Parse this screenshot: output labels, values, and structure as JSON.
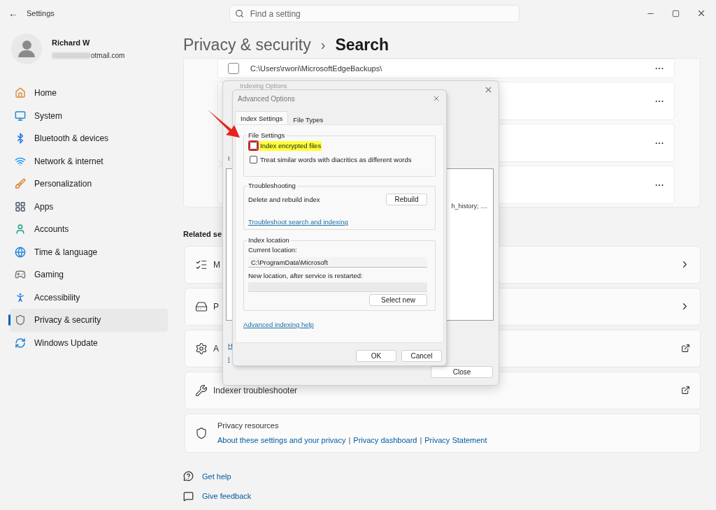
{
  "window": {
    "title": "Settings",
    "back": "←"
  },
  "search": {
    "placeholder": "Find a setting"
  },
  "user": {
    "name": "Richard W",
    "email": "otmail.com"
  },
  "sidebar": {
    "items": [
      {
        "label": "Home",
        "selected": false
      },
      {
        "label": "System",
        "selected": false
      },
      {
        "label": "Bluetooth & devices",
        "selected": false
      },
      {
        "label": "Network & internet",
        "selected": false
      },
      {
        "label": "Personalization",
        "selected": false
      },
      {
        "label": "Apps",
        "selected": false
      },
      {
        "label": "Accounts",
        "selected": false
      },
      {
        "label": "Time & language",
        "selected": false
      },
      {
        "label": "Gaming",
        "selected": false
      },
      {
        "label": "Accessibility",
        "selected": false
      },
      {
        "label": "Privacy & security",
        "selected": true
      },
      {
        "label": "Windows Update",
        "selected": false
      }
    ]
  },
  "header": {
    "parent": "Privacy & security",
    "separator": "›",
    "current": "Search"
  },
  "excluded_folders": [
    {
      "path": "C:\\Users\\rwori\\MicrosoftEdgeBackups\\",
      "checked": false,
      "more": "..."
    },
    {
      "more": "..."
    },
    {
      "more": "..."
    },
    {
      "more": "..."
    }
  ],
  "related": {
    "heading": "Related se",
    "cards": [
      {
        "title": "M"
      },
      {
        "title": "P"
      },
      {
        "title": "A"
      },
      {
        "title": "Indexer troubleshooter"
      }
    ]
  },
  "privacy_resources": {
    "title": "Privacy resources",
    "separator": "|",
    "links": [
      "About these settings and your privacy",
      "Privacy dashboard",
      "Privacy Statement"
    ]
  },
  "help_links": [
    {
      "label": "Get help"
    },
    {
      "label": "Give feedback"
    }
  ],
  "indexing_dialog": {
    "title": "Indexing Options",
    "label_fragment": "I",
    "list_text": "h_history; ....",
    "link_fragments": [
      "H",
      "I"
    ],
    "close_button": "Close"
  },
  "advanced_dialog": {
    "title": "Advanced Options",
    "tabs": [
      {
        "label": "Index Settings",
        "selected": true
      },
      {
        "label": "File Types",
        "selected": false
      }
    ],
    "file_settings": {
      "legend": "File Settings",
      "options": [
        {
          "label": "Index encrypted files",
          "checked": false,
          "highlighted": true,
          "annotated": true
        },
        {
          "label": "Treat similar words with diacritics as different words",
          "checked": false,
          "highlighted": false,
          "annotated": false
        }
      ]
    },
    "troubleshooting": {
      "legend": "Troubleshooting",
      "label": "Delete and rebuild index",
      "button": "Rebuild",
      "link": "Troubleshoot search and indexing"
    },
    "index_location": {
      "legend": "Index location",
      "current_label": "Current location:",
      "current_value": "C:\\ProgramData\\Microsoft",
      "new_label": "New location, after service is restarted:",
      "button": "Select new"
    },
    "help_link": "Advanced indexing help",
    "buttons": [
      "OK",
      "Cancel"
    ]
  }
}
